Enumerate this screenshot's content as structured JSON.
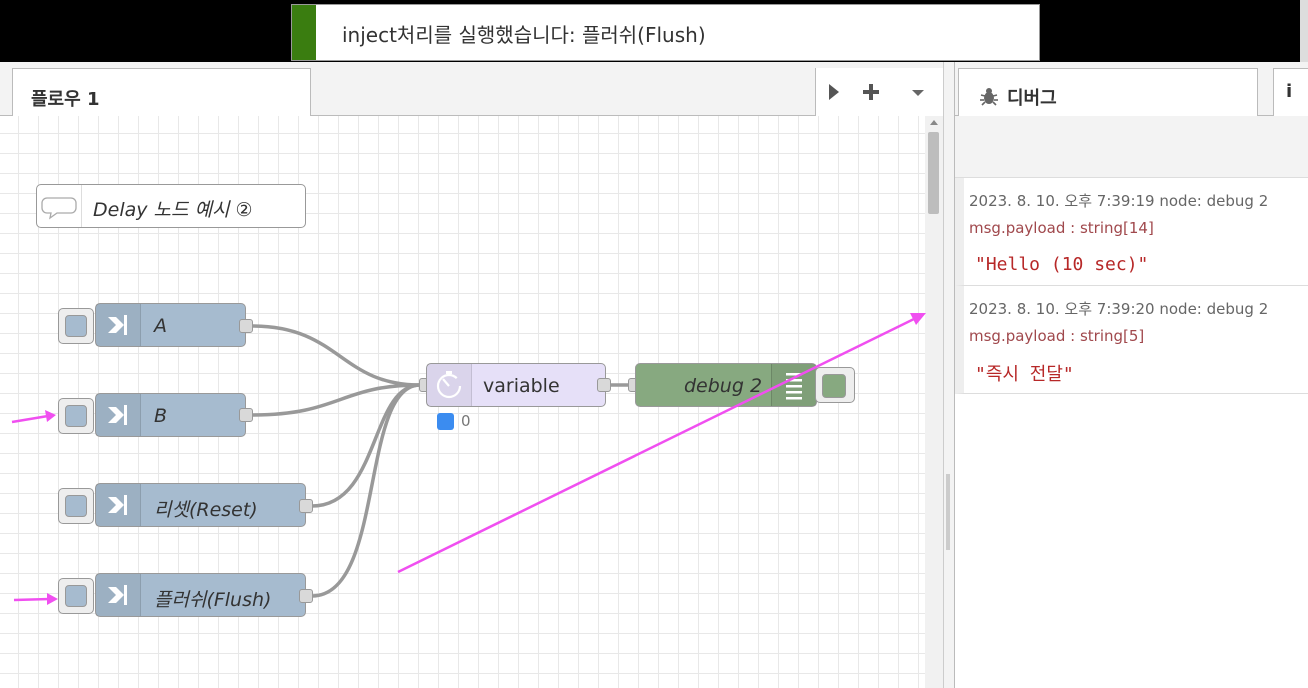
{
  "notification": {
    "text": "inject처리를 실행했습니다: 플러쉬(Flush)",
    "accent_color": "#3a7d10"
  },
  "workspace": {
    "tab_label": "플로우 1",
    "tools": {
      "deploy_icon": "play-triangle-icon",
      "add_icon": "plus-icon",
      "menu_icon": "caret-down-icon"
    }
  },
  "flow": {
    "comment": {
      "text": "Delay 노드 예시 ②"
    },
    "inject_nodes": [
      {
        "label": "A"
      },
      {
        "label": "B"
      },
      {
        "label": "리셋(Reset)"
      },
      {
        "label": "플러쉬(Flush)"
      }
    ],
    "delay_node": {
      "label": "variable",
      "status_text": "0",
      "status_color": "#3b8cf0"
    },
    "debug_node": {
      "label": "debug 2"
    },
    "annotation_color": "#f04ff0"
  },
  "sidebar": {
    "tab_label": "디버그",
    "tab_icon": "bug-icon",
    "info_tab": "i",
    "messages": [
      {
        "meta": "2023. 8. 10. 오후 7:39:19   node: debug 2",
        "topic": "msg.payload : string[14]",
        "value": "\"Hello (10 sec)\""
      },
      {
        "meta": "2023. 8. 10. 오후 7:39:20   node: debug 2",
        "topic": "msg.payload : string[5]",
        "value": "\"즉시 전달\""
      }
    ]
  }
}
